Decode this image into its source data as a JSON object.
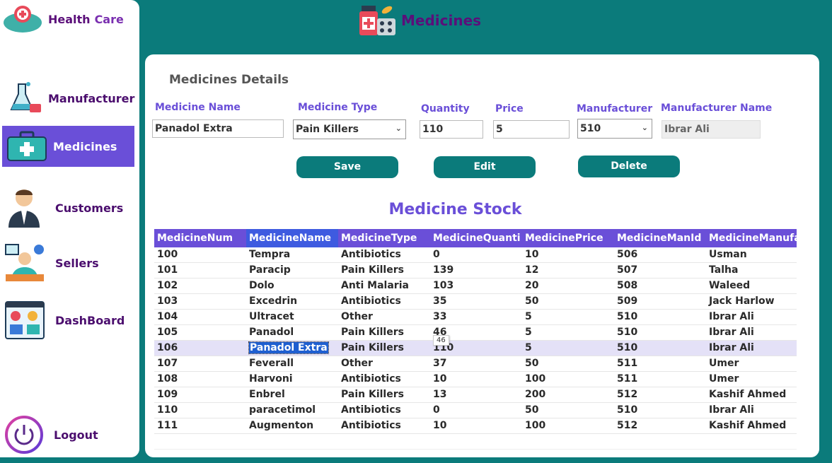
{
  "app": {
    "name_a": "Health",
    "name_b": "Care"
  },
  "nav": [
    {
      "label": "Manufacturer",
      "icon": "flask-icon"
    },
    {
      "label": "Medicines",
      "icon": "medkit-icon"
    },
    {
      "label": "Customers",
      "icon": "person-icon"
    },
    {
      "label": "Sellers",
      "icon": "seller-icon"
    },
    {
      "label": "DashBoard",
      "icon": "dashboard-icon"
    },
    {
      "label": "Logout",
      "icon": "power-icon"
    }
  ],
  "header": {
    "title": "Medicines"
  },
  "form": {
    "section_title": "Medicines Details",
    "name_label": "Medicine Name",
    "name_value": "Panadol Extra",
    "type_label": "Medicine Type",
    "type_value": "Pain Killers",
    "qty_label": "Quantity",
    "qty_value": "110",
    "price_label": "Price",
    "price_value": "5",
    "manufacturer_label": "Manufacturer",
    "manufacturer_value": "510",
    "manufacturer_name_label": "Manufacturer Name",
    "manufacturer_name_value": "Ibrar Ali"
  },
  "buttons": {
    "save": "Save",
    "edit": "Edit",
    "delete": "Delete"
  },
  "stock": {
    "title": "Medicine Stock",
    "columns": [
      "MedicineNum",
      "MedicineName",
      "MedicineType",
      "MedicineQuanti",
      "MedicinePrice",
      "MedicineManId",
      "MedicineManufa"
    ],
    "rows": [
      [
        "100",
        "Tempra",
        "Antibiotics",
        "0",
        "10",
        "506",
        "Usman"
      ],
      [
        "101",
        "Paracip",
        "Pain Killers",
        "139",
        "12",
        "507",
        "Talha"
      ],
      [
        "102",
        "Dolo",
        "Anti Malaria",
        "103",
        "20",
        "508",
        "Waleed"
      ],
      [
        "103",
        "Excedrin",
        "Antibiotics",
        "35",
        "50",
        "509",
        "Jack Harlow"
      ],
      [
        "104",
        "Ultracet",
        "Other",
        "33",
        "5",
        "510",
        "Ibrar Ali"
      ],
      [
        "105",
        "Panadol",
        "Pain Killers",
        "46",
        "5",
        "510",
        "Ibrar Ali"
      ],
      [
        "106",
        "Panadol Extra",
        "Pain Killers",
        "110",
        "5",
        "510",
        "Ibrar Ali"
      ],
      [
        "107",
        "Feverall",
        "Other",
        "37",
        "50",
        "511",
        "Umer"
      ],
      [
        "108",
        "Harvoni",
        "Antibiotics",
        "10",
        "100",
        "511",
        "Umer"
      ],
      [
        "109",
        "Enbrel",
        "Pain Killers",
        "13",
        "200",
        "512",
        "Kashif Ahmed"
      ],
      [
        "110",
        "paracetimol",
        "Antibiotics",
        "0",
        "50",
        "510",
        "Ibrar Ali"
      ],
      [
        "111",
        "Augmenton",
        "Antibiotics",
        "10",
        "100",
        "512",
        "Kashif Ahmed"
      ]
    ],
    "tooltip": "46"
  }
}
